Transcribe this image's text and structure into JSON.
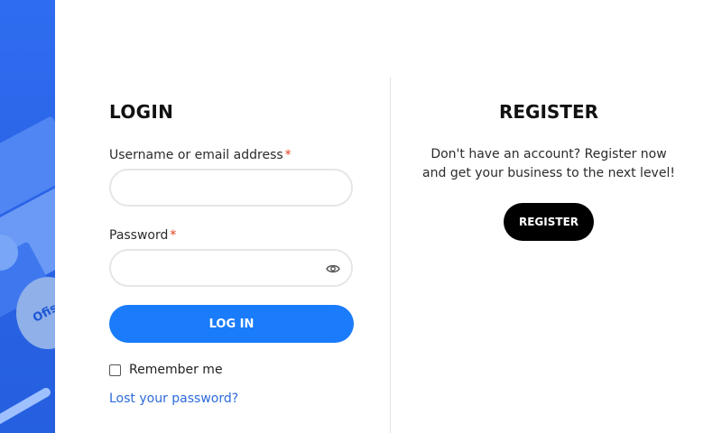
{
  "side_image": {
    "brand_text": "Ofis"
  },
  "login": {
    "title": "LOGIN",
    "username_label": "Username or email address",
    "password_label": "Password",
    "required_marker": "*",
    "submit_label": "LOG IN",
    "remember_label": "Remember me",
    "lost_password_label": "Lost your password?"
  },
  "register": {
    "title": "REGISTER",
    "description": "Don't have an account? Register now and get your business to the next level!",
    "button_label": "REGISTER"
  },
  "colors": {
    "accent": "#1a7cfa",
    "link": "#2d6bdc",
    "required": "#e2401c",
    "dark_button": "#000000",
    "side_panel": "#2a63e6"
  },
  "icons": {
    "password_toggle": "eye-icon"
  }
}
